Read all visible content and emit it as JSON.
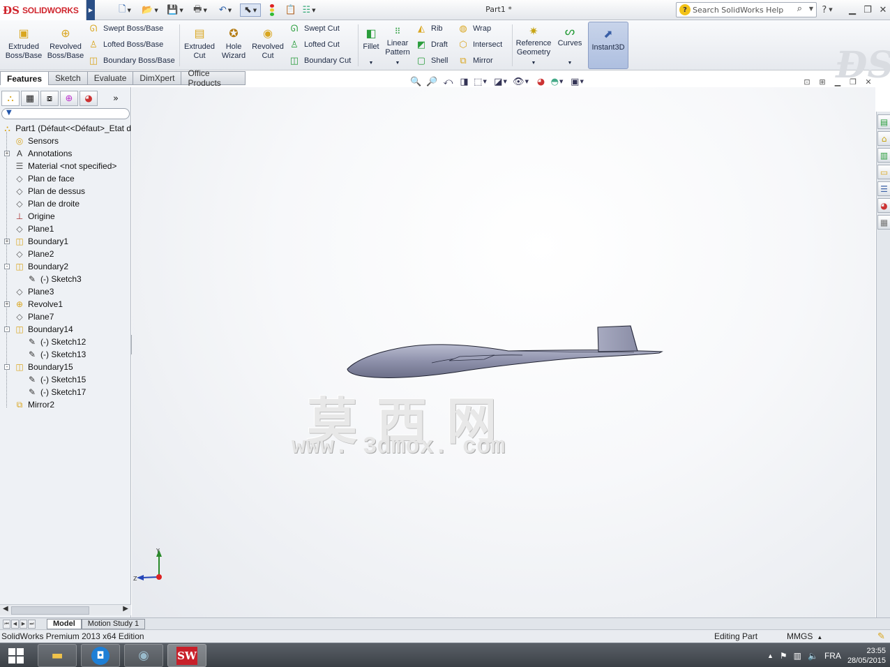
{
  "app": {
    "logo_text": "SOLIDWORKS",
    "doc_title": "Part1 *",
    "search_placeholder": "Search SolidWorks Help",
    "accent": "#d0262e"
  },
  "quick_access": [
    {
      "icon": "new-document-icon"
    },
    {
      "icon": "open-folder-icon"
    },
    {
      "icon": "save-icon"
    },
    {
      "icon": "print-icon"
    },
    {
      "icon": "undo-icon"
    },
    {
      "icon": "select-arrow-icon"
    },
    {
      "icon": "rebuild-traffic-light-icon"
    },
    {
      "icon": "file-properties-icon"
    },
    {
      "icon": "options-icon"
    }
  ],
  "features_toolbar": {
    "extruded_boss": "Extruded Boss/Base",
    "revolved_boss": "Revolved Boss/Base",
    "swept_boss": "Swept Boss/Base",
    "lofted_boss": "Lofted Boss/Base",
    "boundary_boss": "Boundary Boss/Base",
    "extruded_cut": "Extruded Cut",
    "hole_wizard": "Hole Wizard",
    "revolved_cut": "Revolved Cut",
    "swept_cut": "Swept Cut",
    "lofted_cut": "Lofted Cut",
    "boundary_cut": "Boundary Cut",
    "fillet": "Fillet",
    "linear_pattern": "Linear Pattern",
    "rib": "Rib",
    "draft": "Draft",
    "shell": "Shell",
    "wrap": "Wrap",
    "intersect": "Intersect",
    "mirror": "Mirror",
    "reference_geometry": "Reference Geometry",
    "curves": "Curves",
    "instant3d": "Instant3D"
  },
  "tabs": [
    "Features",
    "Sketch",
    "Evaluate",
    "DimXpert",
    "Office Products"
  ],
  "feature_tree": [
    {
      "label": "Part1  (Défaut<<Défaut>_Etat d",
      "icon": "part-icon",
      "level": 0,
      "expander": ""
    },
    {
      "label": "Sensors",
      "icon": "sensors-icon",
      "level": 1,
      "expander": ""
    },
    {
      "label": "Annotations",
      "icon": "annotations-icon",
      "level": 1,
      "expander": "+"
    },
    {
      "label": "Material <not specified>",
      "icon": "material-icon",
      "level": 1,
      "expander": ""
    },
    {
      "label": "Plan de face",
      "icon": "plane-icon",
      "level": 1,
      "expander": ""
    },
    {
      "label": "Plan de dessus",
      "icon": "plane-icon",
      "level": 1,
      "expander": ""
    },
    {
      "label": "Plan de droite",
      "icon": "plane-icon",
      "level": 1,
      "expander": ""
    },
    {
      "label": "Origine",
      "icon": "origin-icon",
      "level": 1,
      "expander": ""
    },
    {
      "label": "Plane1",
      "icon": "plane-icon",
      "level": 1,
      "expander": ""
    },
    {
      "label": "Boundary1",
      "icon": "boundary-icon",
      "level": 1,
      "expander": "+"
    },
    {
      "label": "Plane2",
      "icon": "plane-icon",
      "level": 1,
      "expander": ""
    },
    {
      "label": "Boundary2",
      "icon": "boundary-icon",
      "level": 1,
      "expander": "-"
    },
    {
      "label": "(-) Sketch3",
      "icon": "sketch-icon",
      "level": 2,
      "expander": ""
    },
    {
      "label": "Plane3",
      "icon": "plane-icon",
      "level": 1,
      "expander": ""
    },
    {
      "label": "Revolve1",
      "icon": "revolve-icon",
      "level": 1,
      "expander": "+"
    },
    {
      "label": "Plane7",
      "icon": "plane-icon",
      "level": 1,
      "expander": ""
    },
    {
      "label": "Boundary14",
      "icon": "boundary-icon",
      "level": 1,
      "expander": "-"
    },
    {
      "label": "(-) Sketch12",
      "icon": "sketch-icon",
      "level": 2,
      "expander": ""
    },
    {
      "label": "(-) Sketch13",
      "icon": "sketch-icon",
      "level": 2,
      "expander": ""
    },
    {
      "label": "Boundary15",
      "icon": "boundary-icon",
      "level": 1,
      "expander": "-"
    },
    {
      "label": "(-) Sketch15",
      "icon": "sketch-icon",
      "level": 2,
      "expander": ""
    },
    {
      "label": "(-) Sketch17",
      "icon": "sketch-icon",
      "level": 2,
      "expander": ""
    },
    {
      "label": "Mirror2",
      "icon": "mirror-icon",
      "level": 1,
      "expander": ""
    }
  ],
  "viewport": {
    "watermark_cn": "莫西网",
    "watermark_url": "www. 3dmox. com",
    "triad_y": "Y",
    "triad_z": "Z"
  },
  "bottom_tabs": [
    "Model",
    "Motion Study 1"
  ],
  "status": {
    "edition": "SolidWorks Premium 2013 x64 Edition",
    "mode": "Editing Part",
    "units": "MMGS"
  },
  "taskbar": {
    "language": "FRA",
    "time": "23:55",
    "date": "28/05/2015"
  }
}
